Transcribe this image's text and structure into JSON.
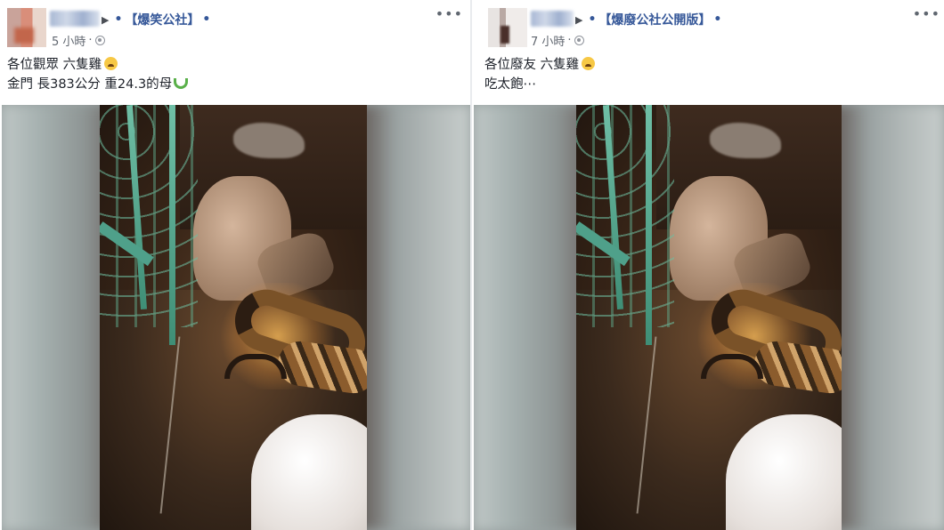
{
  "posts": [
    {
      "group": "【爆笑公社】",
      "time": "5 小時",
      "line1": "各位觀眾 六隻雞",
      "line2": "金門 長383公分 重24.3的母"
    },
    {
      "group": "【爆廢公社公開版】",
      "time": "7 小時",
      "line1": "各位廢友 六隻雞",
      "line2": "吃太飽⋯"
    }
  ],
  "glyphs": {
    "more": "•••",
    "arrow": "▶",
    "dot": "•",
    "meta_sep": "·"
  },
  "icons": [
    "more-options-icon",
    "globe-icon",
    "crying-emoji-icon",
    "snake-emoji-icon"
  ]
}
